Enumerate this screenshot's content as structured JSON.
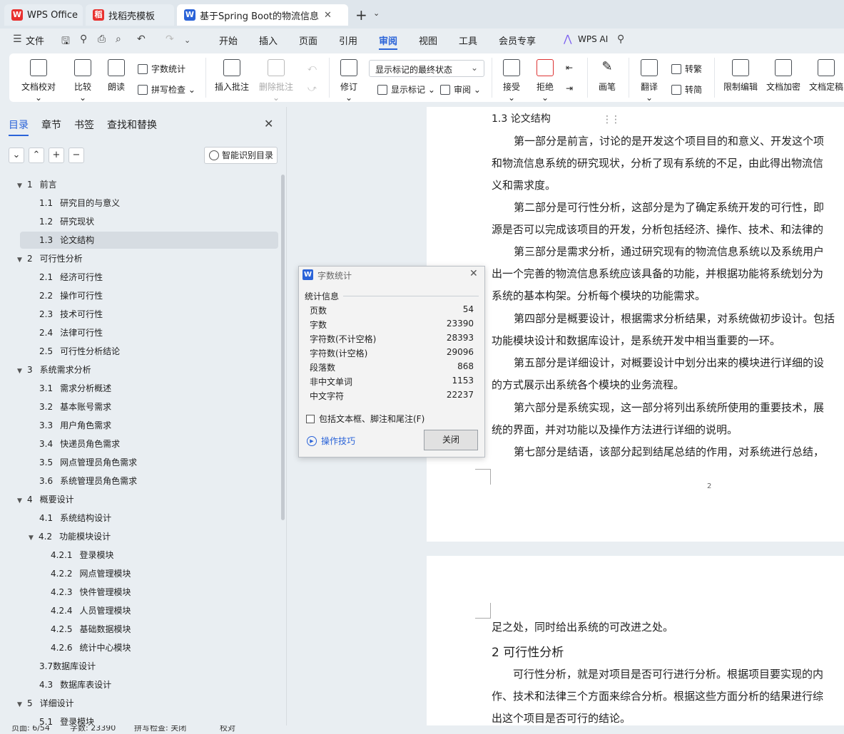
{
  "titlebar": {
    "tabs": [
      {
        "label": "WPS Office",
        "icon": "wps-logo-icon",
        "icon_color": "#e8312f"
      },
      {
        "label": "找稻壳模板",
        "icon": "docer-icon",
        "icon_color": "#e8312f"
      },
      {
        "label": "基于Spring Boot的物流信息管",
        "icon": "wps-writer-icon",
        "icon_color": "#2a63d8",
        "active": true
      }
    ]
  },
  "menubar": {
    "file": "文件",
    "items": [
      "开始",
      "插入",
      "页面",
      "引用",
      "审阅",
      "视图",
      "工具",
      "会员专享"
    ],
    "active": "审阅",
    "ai": "WPS AI"
  },
  "ribbon": {
    "doc_check": "文档校对",
    "compare": "比较",
    "read_aloud": "朗读",
    "word_count": "字数统计",
    "spell_check": "拼写检查",
    "insert_comment": "插入批注",
    "delete_comment": "删除批注",
    "track_changes": "修订",
    "markup_state": "显示标记的最终状态",
    "show_markup": "显示标记",
    "review": "审阅",
    "accept": "接受",
    "reject": "拒绝",
    "pen": "画笔",
    "translate": "翻译",
    "to_traditional": "转繁",
    "to_simplified": "转简",
    "restrict_edit": "限制编辑",
    "encrypt": "文档加密",
    "finalize": "文档定稿"
  },
  "nav": {
    "tabs": [
      "目录",
      "章节",
      "书签",
      "查找和替换"
    ],
    "active_tab": "目录",
    "smart_toc": "智能识别目录",
    "toc": [
      {
        "num": "1",
        "text": "前言",
        "level": 1,
        "expanded": true
      },
      {
        "num": "1.1",
        "text": "研究目的与意义",
        "level": 2
      },
      {
        "num": "1.2",
        "text": "研究现状",
        "level": 2
      },
      {
        "num": "1.3",
        "text": "论文结构",
        "level": 2,
        "selected": true
      },
      {
        "num": "2",
        "text": "可行性分析",
        "level": 1,
        "expanded": true
      },
      {
        "num": "2.1",
        "text": "经济可行性",
        "level": 2
      },
      {
        "num": "2.2",
        "text": "操作可行性",
        "level": 2
      },
      {
        "num": "2.3",
        "text": "技术可行性",
        "level": 2
      },
      {
        "num": "2.4",
        "text": "法律可行性",
        "level": 2
      },
      {
        "num": "2.5",
        "text": "可行性分析结论",
        "level": 2
      },
      {
        "num": "3",
        "text": "系统需求分析",
        "level": 1,
        "expanded": true
      },
      {
        "num": "3.1",
        "text": "需求分析概述",
        "level": 2
      },
      {
        "num": "3.2",
        "text": "基本账号需求",
        "level": 2
      },
      {
        "num": "3.3",
        "text": "用户角色需求",
        "level": 2
      },
      {
        "num": "3.4",
        "text": "快递员角色需求",
        "level": 2
      },
      {
        "num": "3.5",
        "text": "网点管理员角色需求",
        "level": 2
      },
      {
        "num": "3.6",
        "text": "系统管理员角色需求",
        "level": 2
      },
      {
        "num": "4",
        "text": "概要设计",
        "level": 1,
        "expanded": true
      },
      {
        "num": "4.1",
        "text": "系统结构设计",
        "level": 2
      },
      {
        "num": "4.2",
        "text": "功能模块设计",
        "level": 2,
        "expanded": true
      },
      {
        "num": "4.2.1",
        "text": "登录模块",
        "level": 3
      },
      {
        "num": "4.2.2",
        "text": "网点管理模块",
        "level": 3
      },
      {
        "num": "4.2.3",
        "text": "快件管理模块",
        "level": 3
      },
      {
        "num": "4.2.4",
        "text": "人员管理模块",
        "level": 3
      },
      {
        "num": "4.2.5",
        "text": "基础数据模块",
        "level": 3
      },
      {
        "num": "4.2.6",
        "text": "统计中心模块",
        "level": 3
      },
      {
        "num": "",
        "text": "3.7数据库设计",
        "level": 2
      },
      {
        "num": "4.3",
        "text": "数据库表设计",
        "level": 2
      },
      {
        "num": "5",
        "text": "详细设计",
        "level": 1,
        "expanded": true
      },
      {
        "num": "5.1",
        "text": "登录模块",
        "level": 2
      }
    ]
  },
  "document": {
    "page1": {
      "heading": "1.3   论文结构",
      "lines": [
        "第一部分是前言，讨论的是开发这个项目目的和意义、开发这个项",
        "和物流信息系统的研究现状，分析了现有系统的不足，由此得出物流信",
        "义和需求度。",
        "第二部分是可行性分析，这部分是为了确定系统开发的可行性，即",
        "源是否可以完成该项目的开发，分析包括经济、操作、技术、和法律的",
        "第三部分是需求分析，通过研究现有的物流信息系统以及系统用户",
        "出一个完善的物流信息系统应该具备的功能，并根据功能将系统划分为",
        "系统的基本构架。分析每个模块的功能需求。",
        "第四部分是概要设计，根据需求分析结果，对系统做初步设计。包括",
        "功能模块设计和数据库设计，是系统开发中相当重要的一环。",
        "第五部分是详细设计，对概要设计中划分出来的模块进行详细的设",
        "的方式展示出系统各个模块的业务流程。",
        "第六部分是系统实现，这一部分将列出系统所使用的重要技术，展",
        "统的界面，并对功能以及操作方法进行详细的说明。",
        "第七部分是结语，该部分起到结尾总结的作用，对系统进行总结，"
      ],
      "page_number": "2"
    },
    "page2": {
      "lines": [
        "足之处，同时给出系统的可改进之处。",
        "可行性分析，就是对项目是否可行进行分析。根据项目要实现的内",
        "作、技术和法律三个方面来综合分析。根据这些方面分析的结果进行综",
        "出这个项目是否可行的结论。"
      ],
      "heading": "2    可行性分析"
    }
  },
  "dialog": {
    "title": "字数统计",
    "group": "统计信息",
    "stats": [
      {
        "label": "页数",
        "value": "54"
      },
      {
        "label": "字数",
        "value": "23390"
      },
      {
        "label": "字符数(不计空格)",
        "value": "28393"
      },
      {
        "label": "字符数(计空格)",
        "value": "29096"
      },
      {
        "label": "段落数",
        "value": "868"
      },
      {
        "label": "非中文单词",
        "value": "1153"
      },
      {
        "label": "中文字符",
        "value": "22237"
      }
    ],
    "checkbox": "包括文本框、脚注和尾注(F)",
    "tips": "操作技巧",
    "close": "关闭"
  },
  "statusbar": {
    "page": "页面: 6/54",
    "words": "字数: 23390",
    "spell": "拼写检查: 关闭",
    "proof": "校对"
  }
}
